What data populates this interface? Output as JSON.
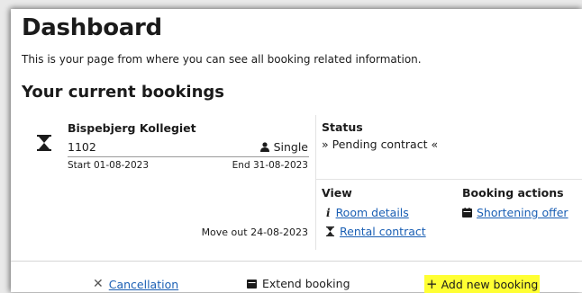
{
  "page": {
    "title": "Dashboard",
    "subtitle": "This is your page from where you can see all booking related information.",
    "section_title": "Your current bookings"
  },
  "booking": {
    "property": "Bispebjerg Kollegiet",
    "room": "1102",
    "room_type": "Single",
    "start": "Start 01-08-2023",
    "end": "End 31-08-2023",
    "move_out": "Move out 24-08-2023",
    "status_label": "Status",
    "status_value": "» Pending contract «",
    "view_label": "View",
    "room_details_link": "Room details",
    "rental_contract_link": "Rental contract",
    "booking_actions_label": "Booking actions",
    "shortening_offer_link": "Shortening offer",
    "status_icon": "hourglass-icon"
  },
  "actions": {
    "cancellation": "Cancellation",
    "extend_booking": "Extend booking",
    "add_new_booking": "Add new booking"
  },
  "colors": {
    "link": "#1a5fb4",
    "highlight": "#ffff33"
  }
}
